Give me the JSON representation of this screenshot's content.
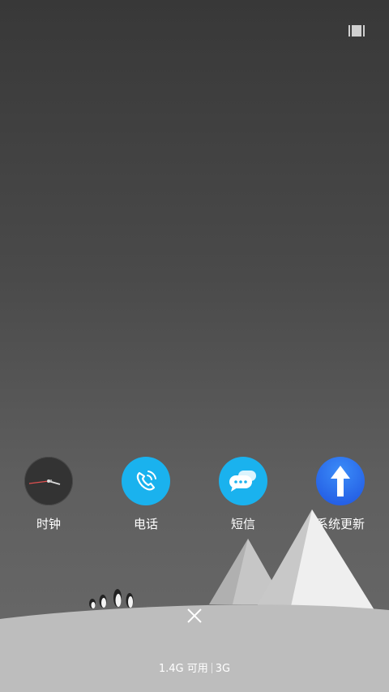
{
  "recents_button": {
    "icon": "recents-view-icon"
  },
  "apps": [
    {
      "label": "时钟",
      "icon": "clock-icon",
      "color": "#3a3a3a"
    },
    {
      "label": "电话",
      "icon": "phone-icon",
      "color": "#1ab2ee"
    },
    {
      "label": "短信",
      "icon": "message-icon",
      "color": "#1ab2ee"
    },
    {
      "label": "系统更新",
      "icon": "arrow-up-icon",
      "color": "#2364ee"
    }
  ],
  "close_button": {
    "icon": "close-icon"
  },
  "memory": {
    "available": "1.4G 可用",
    "total": "3G"
  }
}
